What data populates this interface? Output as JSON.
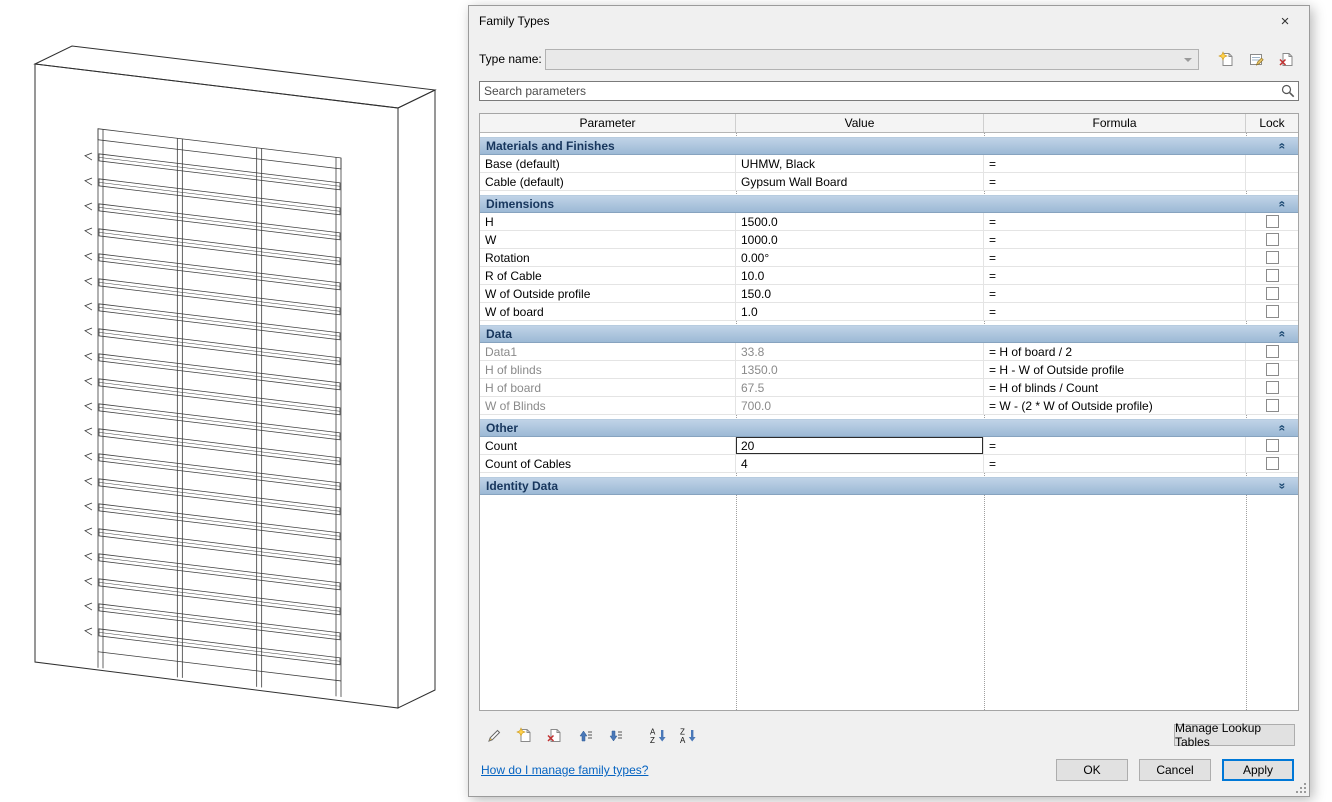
{
  "window": {
    "title": "Family Types",
    "close_glyph": "×"
  },
  "type_name": {
    "label": "Type name:",
    "value": "",
    "icons": [
      "new-type",
      "rename-type",
      "delete-type"
    ]
  },
  "search": {
    "placeholder": "Search parameters",
    "icon": "search"
  },
  "table": {
    "columns": [
      "Parameter",
      "Value",
      "Formula",
      "Lock"
    ],
    "groups": [
      {
        "name": "Materials and Finishes",
        "collapsed": false,
        "rows": [
          {
            "parameter": "Base (default)",
            "value": "UHMW, Black",
            "formula": "=",
            "lock": null
          },
          {
            "parameter": "Cable (default)",
            "value": "Gypsum Wall Board",
            "formula": "=",
            "lock": null
          }
        ]
      },
      {
        "name": "Dimensions",
        "collapsed": false,
        "rows": [
          {
            "parameter": "H",
            "value": "1500.0",
            "formula": "=",
            "lock": false
          },
          {
            "parameter": "W",
            "value": "1000.0",
            "formula": "=",
            "lock": false
          },
          {
            "parameter": "Rotation",
            "value": "0.00°",
            "formula": "=",
            "lock": false
          },
          {
            "parameter": "R of Cable",
            "value": "10.0",
            "formula": "=",
            "lock": false
          },
          {
            "parameter": "W of Outside profile",
            "value": "150.0",
            "formula": "=",
            "lock": false
          },
          {
            "parameter": "W of board",
            "value": "1.0",
            "formula": "=",
            "lock": false
          }
        ]
      },
      {
        "name": "Data",
        "collapsed": false,
        "rows": [
          {
            "parameter": "Data1",
            "value": "33.8",
            "formula": "= H of board / 2",
            "lock": false,
            "grayed": true
          },
          {
            "parameter": "H of blinds",
            "value": "1350.0",
            "formula": "= H - W of Outside profile",
            "lock": false,
            "grayed": true
          },
          {
            "parameter": "H of board",
            "value": "67.5",
            "formula": "= H of blinds / Count",
            "lock": false,
            "grayed": true
          },
          {
            "parameter": "W of Blinds",
            "value": "700.0",
            "formula": "= W - (2 * W of Outside profile)",
            "lock": false,
            "grayed": true
          }
        ]
      },
      {
        "name": "Other",
        "collapsed": false,
        "rows": [
          {
            "parameter": "Count",
            "value": "20",
            "formula": "=",
            "lock": false,
            "editing": true
          },
          {
            "parameter": "Count of Cables",
            "value": "4",
            "formula": "=",
            "lock": false
          }
        ]
      },
      {
        "name": "Identity Data",
        "collapsed": true,
        "rows": []
      }
    ]
  },
  "toolbar": {
    "icons": [
      "edit-parameter",
      "new-parameter",
      "delete-parameter",
      "move-parameter-up",
      "move-parameter-down",
      "sort-ascending",
      "sort-descending"
    ],
    "manage_lookup_tables_label": "Manage Lookup Tables"
  },
  "footer": {
    "help_link": "How do I manage family types?",
    "ok_label": "OK",
    "cancel_label": "Cancel",
    "apply_label": "Apply"
  }
}
